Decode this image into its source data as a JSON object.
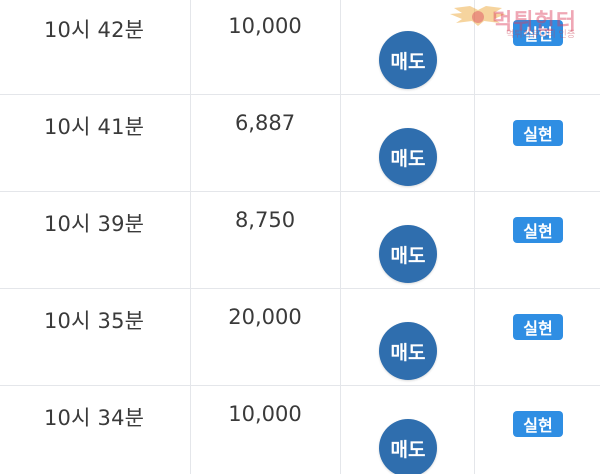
{
  "rows": [
    {
      "time": "10시 42분",
      "amount": "10,000",
      "side": "매도",
      "status": "실현"
    },
    {
      "time": "10시 41분",
      "amount": "6,887",
      "side": "매도",
      "status": "실현"
    },
    {
      "time": "10시 39분",
      "amount": "8,750",
      "side": "매도",
      "status": "실현"
    },
    {
      "time": "10시 35분",
      "amount": "20,000",
      "side": "매도",
      "status": "실현"
    },
    {
      "time": "10시 34분",
      "amount": "10,000",
      "side": "매도",
      "status": "실현"
    }
  ],
  "watermark": {
    "text": "먹튀헌터",
    "subtext": "먹튀커뮤니티 인증"
  },
  "colors": {
    "sell_button": "#2f6eae",
    "status_badge": "#2f8ee3",
    "divider": "#e4e6ea",
    "text": "#3a3a3a"
  }
}
